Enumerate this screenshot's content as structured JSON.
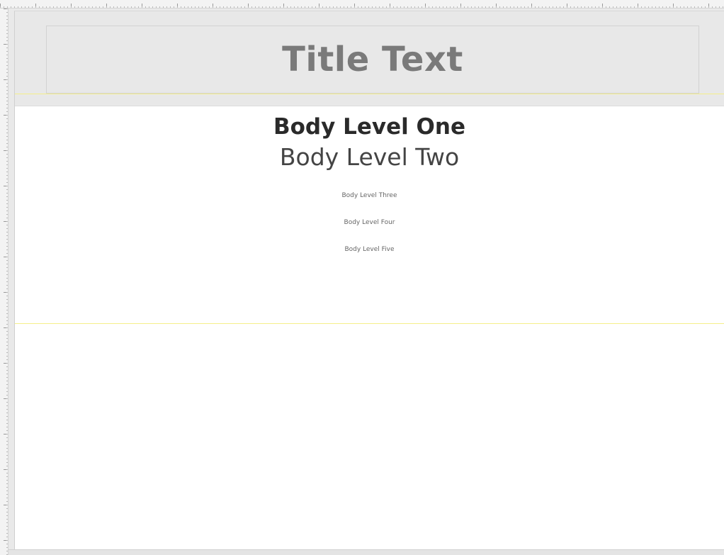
{
  "slide": {
    "title": "Title Text",
    "body_level_one": "Body Level One",
    "body_level_two": "Body Level Two",
    "body_level_three": "Body Level Three",
    "body_level_four": "Body Level Four",
    "body_level_five": "Body Level Five"
  },
  "colors": {
    "title_band": "#e8e8e8",
    "title_text": "#7a7a7a",
    "guide_line": "#f5ef8a",
    "slide_background": "#ffffff"
  }
}
